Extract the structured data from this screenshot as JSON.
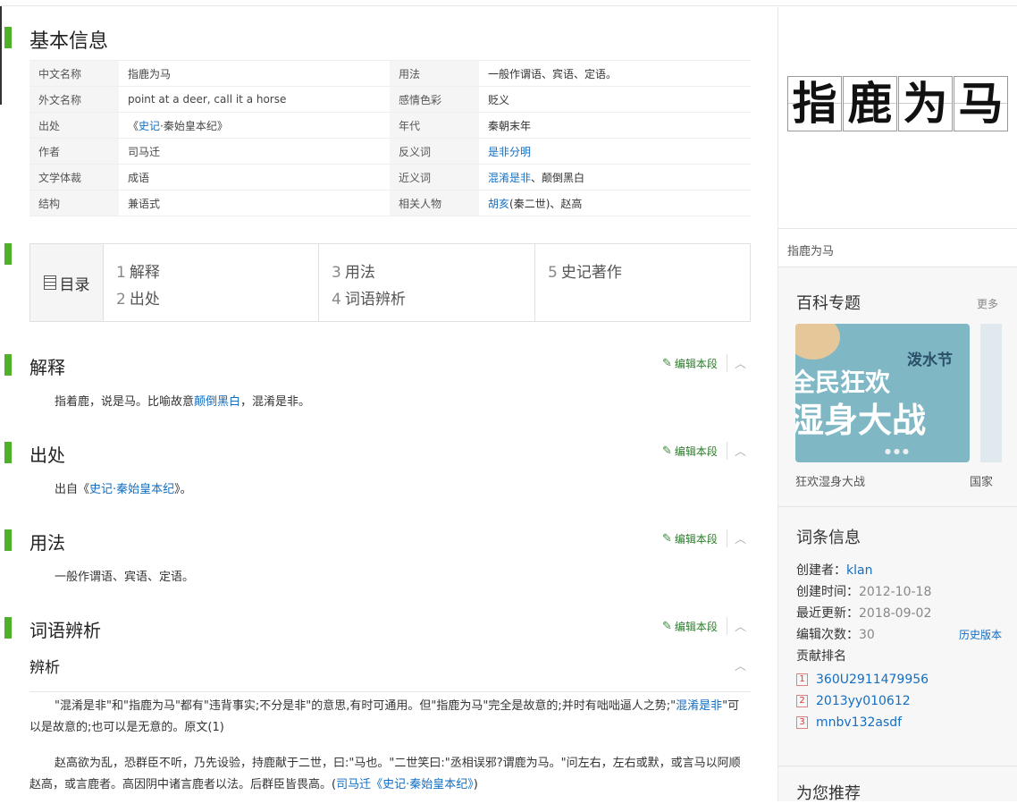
{
  "sections": {
    "basic_info": "基本信息",
    "explain": "解释",
    "origin": "出处",
    "usage": "用法",
    "discern": "词语辨析",
    "discern_sub": "辨析"
  },
  "info_table": [
    {
      "k1": "中文名称",
      "v1": "指鹿为马",
      "k2": "用法",
      "v2": "一般作谓语、宾语、定语。"
    },
    {
      "k1": "外文名称",
      "v1": "point at a deer, call it a horse",
      "k2": "感情色彩",
      "v2": "贬义"
    },
    {
      "k1": "出处",
      "v1a": "《",
      "v1link": "史记",
      "v1b": "·秦始皇本纪》",
      "k2": "年代",
      "v2": "秦朝末年"
    },
    {
      "k1": "作者",
      "v1": "司马迁",
      "k2": "反义词",
      "v2link": "是非分明"
    },
    {
      "k1": "文学体裁",
      "v1": "成语",
      "k2": "近义词",
      "v2link": "混淆是非",
      "v2": "、颠倒黑白"
    },
    {
      "k1": "结构",
      "v1": "兼语式",
      "k2": "相关人物",
      "v2link": "胡亥",
      "v2": "(秦二世)、赵高"
    }
  ],
  "toc": {
    "label": "目录",
    "items": [
      {
        "num": "1",
        "text": "解释"
      },
      {
        "num": "2",
        "text": "出处"
      },
      {
        "num": "3",
        "text": "用法"
      },
      {
        "num": "4",
        "text": "词语辨析"
      },
      {
        "num": "5",
        "text": "史记著作"
      }
    ]
  },
  "edit_label": "编辑本段",
  "explain_text": {
    "a": "指着鹿，说是马。比喻故意",
    "link": "颠倒黑白",
    "b": "，混淆是非。"
  },
  "origin_text": {
    "a": "出自《",
    "link": "史记·秦始皇本纪",
    "b": "》。"
  },
  "usage_text": "一般作谓语、宾语、定语。",
  "discern_p1": {
    "a": "\"混淆是非\"和\"指鹿为马\"都有\"违背事实;不分是非\"的意思,有时可通用。但\"指鹿为马\"完全是故意的;并时有咄咄逼人之势;\"",
    "link": "混淆是非",
    "b": "\"可以是故意的;也可以是无意的。原文(1)"
  },
  "discern_p2": {
    "a": "赵高欲为乱，恐群臣不听，乃先设验，持鹿献于二世，曰:\"马也。\"二世笑曰:\"丞相误邪?谓鹿为马。\"问左右，左右或默，或言马以阿顺赵高，或言鹿者。高因阴中诸言鹿者以法。后群臣皆畏高。(",
    "link": "司马迁《史记·秦始皇本纪》",
    "b": ")"
  },
  "sidebar": {
    "word_chars": [
      "指",
      "鹿",
      "为",
      "马"
    ],
    "caption": "指鹿为马",
    "topics_title": "百科专题",
    "more": "更多",
    "banner_small": "泼水节",
    "banner_line1": "全民狂欢",
    "banner_line2": "湿身大战",
    "banner_caption": "狂欢湿身大战",
    "banner_caption2": "国家",
    "entry_title": "词条信息",
    "creator_label": "创建者：",
    "creator": "klan",
    "created_label": "创建时间：",
    "created": "2012-10-18",
    "updated_label": "最近更新：",
    "updated": "2018-09-02",
    "edits_label": "编辑次数：",
    "edits": "30",
    "history": "历史版本",
    "rank_label": "贡献排名",
    "ranks": [
      {
        "n": "1",
        "name": "360U2911479956"
      },
      {
        "n": "2",
        "name": "2013yy010612"
      },
      {
        "n": "3",
        "name": "mnbv132asdf"
      }
    ],
    "recommend_title": "为您推荐"
  },
  "colors": {
    "accent": "#4fb12a",
    "link": "#136ec2",
    "edit": "#2a7b2a"
  }
}
